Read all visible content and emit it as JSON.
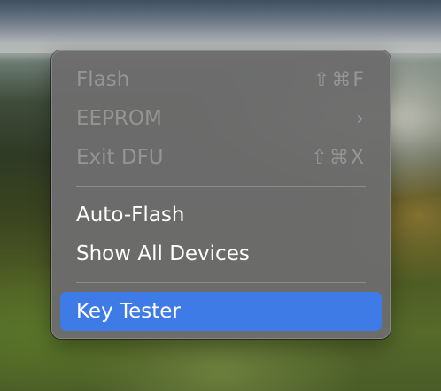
{
  "menu": {
    "items": [
      {
        "label": "Flash",
        "shortcut": "⇧⌘F",
        "enabled": false
      },
      {
        "label": "EEPROM",
        "submenu_indicator": "›",
        "enabled": false
      },
      {
        "label": "Exit DFU",
        "shortcut": "⇧⌘X",
        "enabled": false
      },
      {
        "label": "Auto-Flash",
        "enabled": true
      },
      {
        "label": "Show All Devices",
        "enabled": true
      },
      {
        "label": "Key Tester",
        "enabled": true,
        "highlighted": true
      }
    ]
  },
  "colors": {
    "menu_background": "#6c6c6c",
    "highlight": "#3e7be6",
    "text": "#ffffff"
  }
}
